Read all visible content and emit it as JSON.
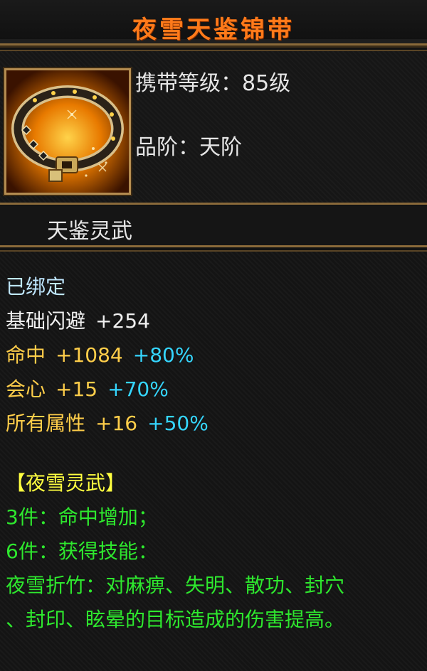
{
  "item": {
    "name": "夜雪天鉴锦带",
    "level_label": "携带等级：85级",
    "grade_label": "品阶：天阶",
    "set_name": "天鉴灵武",
    "bound": "已绑定"
  },
  "stats": [
    {
      "name": "基础闪避",
      "value": "+254",
      "bonus": ""
    },
    {
      "name": "命中",
      "value": "+1084",
      "bonus": "+80%"
    },
    {
      "name": "会心",
      "value": "+15",
      "bonus": "+70%"
    },
    {
      "name": "所有属性",
      "value": "+16",
      "bonus": "+50%"
    }
  ],
  "set_bonus": {
    "title": "【夜雪灵武】",
    "piece3": "3件：命中增加；",
    "piece6": "6件：获得技能：",
    "skill_line1": "夜雪折竹：对麻痹、失明、散功、封穴",
    "skill_line2": "、封印、眩晕的目标造成的伤害提高。"
  },
  "colors": {
    "title": "#ff7a1a",
    "stat_gold": "#ffce4a",
    "bonus_cyan": "#35d6ff",
    "set_title": "#ffff40",
    "set_text": "#2ee82e",
    "frame": "#8a6a3a"
  },
  "icons": {
    "item": "golden-belt-icon"
  }
}
